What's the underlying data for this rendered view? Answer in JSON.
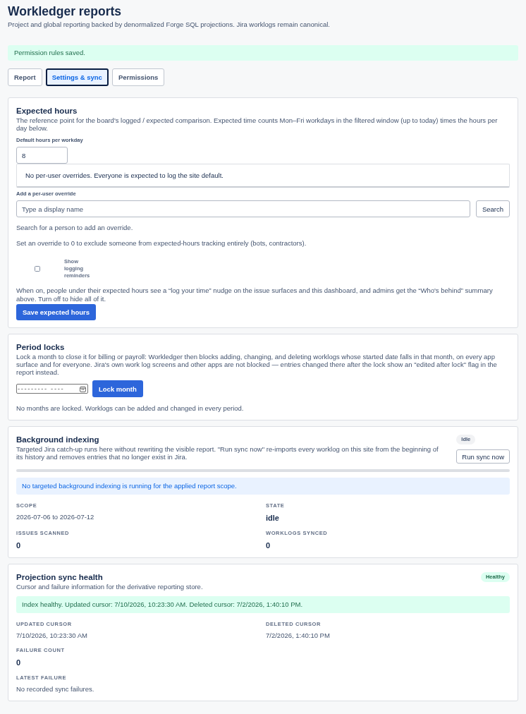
{
  "header": {
    "title": "Workledger reports",
    "subtitle": "Project and global reporting backed by denormalized Forge SQL projections. Jira worklogs remain canonical."
  },
  "banner": {
    "kind": "success",
    "text": "Permission rules saved."
  },
  "tabs": [
    {
      "label": "Report",
      "selected": false
    },
    {
      "label": "Settings & sync",
      "selected": true
    },
    {
      "label": "Permissions",
      "selected": false
    }
  ],
  "expected_hours": {
    "title": "Expected hours",
    "description": "The reference point for the board's logged / expected comparison. Expected time counts Mon–Fri workdays in the filtered window (up to today) times the hours per day below.",
    "default_label": "Default hours per workday",
    "default_value": "8",
    "overrides_empty": "No per-user overrides. Everyone is expected to log the site default.",
    "override_label": "Add a per-user override",
    "override_placeholder": "Type a display name",
    "search_button": "Search",
    "search_hint": "Search for a person to add an override.",
    "zero_hint": "Set an override to 0 to exclude someone from expected-hours tracking entirely (bots, contractors).",
    "reminders": {
      "label": "Show logging reminders",
      "checked": false
    },
    "reminders_note": "When on, people under their expected hours see a “log your time” nudge on the issue surfaces and this dashboard, and admins get the “Who's behind” summary above. Turn off to hide all of it.",
    "save_button": "Save expected hours"
  },
  "period_locks": {
    "title": "Period locks",
    "description": "Lock a month to close it for billing or payroll: Workledger then blocks adding, changing, and deleting worklogs whose started date falls in that month, on every app surface and for everyone. Jira's own work log screens and other apps are not blocked — entries changed there after the lock show an \"edited after lock\" flag in the report instead.",
    "month_value": "--------- ----",
    "lock_button": "Lock month",
    "status": "No months are locked. Worklogs can be added and changed in every period."
  },
  "background_indexing": {
    "title": "Background indexing",
    "description": "Targeted Jira catch-up runs here without rewriting the visible report. \"Run sync now\" re-imports every worklog on this site from the beginning of its history and removes entries that no longer exist in Jira.",
    "badge": {
      "label": "Idle",
      "kind": "neutral"
    },
    "run_button": "Run sync now",
    "notice": {
      "kind": "info",
      "text": "No targeted background indexing is running for the applied report scope."
    },
    "stat_rows": [
      [
        {
          "label": "SCOPE",
          "value": "2026-07-06 to 2026-07-12",
          "kind": "plain"
        },
        {
          "label": "STATE",
          "value": "idle",
          "kind": "metric"
        }
      ],
      [
        {
          "label": "ISSUES SCANNED",
          "value": "0",
          "kind": "metric"
        },
        {
          "label": "WORKLOGS SYNCED",
          "value": "0",
          "kind": "metric"
        }
      ]
    ]
  },
  "projection_health": {
    "title": "Projection sync health",
    "description": "Cursor and failure information for the derivative reporting store.",
    "badge": {
      "label": "Healthy",
      "kind": "success"
    },
    "notice": {
      "kind": "success",
      "text": "Index healthy. Updated cursor: 7/10/2026, 10:23:30 AM. Deleted cursor: 7/2/2026, 1:40:10 PM."
    },
    "stat_rows": [
      [
        {
          "label": "UPDATED CURSOR",
          "value": "7/10/2026, 10:23:30 AM",
          "kind": "plain"
        },
        {
          "label": "DELETED CURSOR",
          "value": "7/2/2026, 1:40:10 PM",
          "kind": "plain"
        }
      ],
      [
        {
          "label": "FAILURE COUNT",
          "value": "0",
          "kind": "metric"
        }
      ],
      [
        {
          "label": "LATEST FAILURE",
          "value": "No recorded sync failures.",
          "kind": "plain"
        }
      ]
    ]
  }
}
